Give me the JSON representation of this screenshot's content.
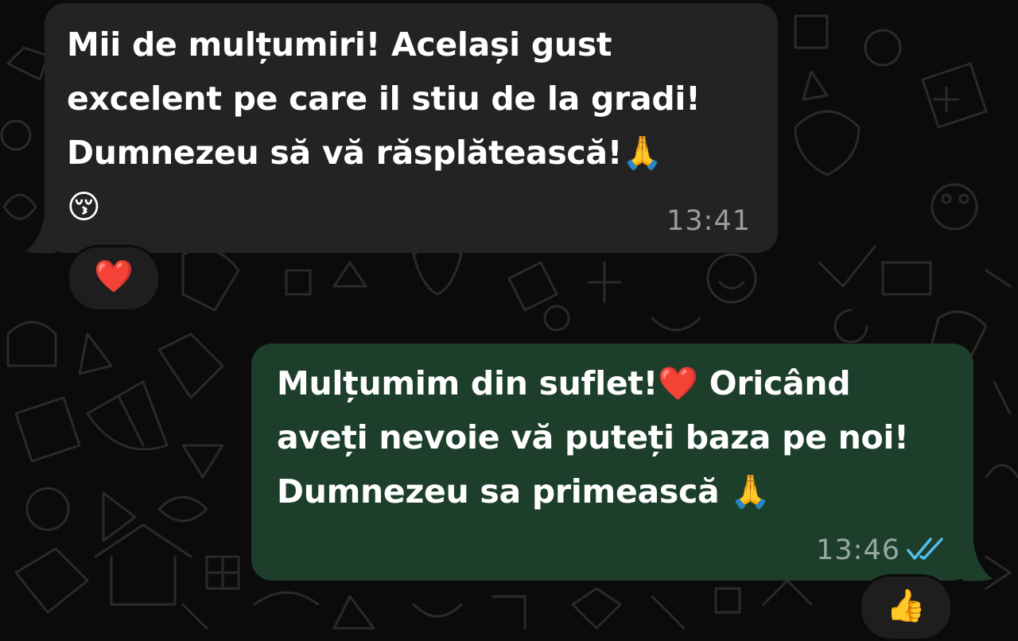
{
  "messages": [
    {
      "direction": "incoming",
      "text": "Mii de mulțumiri! Același gust\nexcelent pe care il stiu de la gradi!\nDumnezeu să vă răsplătească!🙏\n😚",
      "time": "13:41",
      "reaction": "❤️"
    },
    {
      "direction": "outgoing",
      "text": "Mulțumim din suflet!❤️ Oricând\naveți nevoie vă puteți baza pe noi!\nDumnezeu sa primească 🙏",
      "time": "13:46",
      "status": "read",
      "reaction": "👍"
    }
  ],
  "colors": {
    "background": "#0b0b0b",
    "incoming_bubble": "#232323",
    "outgoing_bubble": "#1e3e2c",
    "read_ticks": "#53bdeb",
    "timestamp": "#9a9a9a"
  },
  "icons": {
    "read_status": "double-check-icon"
  }
}
